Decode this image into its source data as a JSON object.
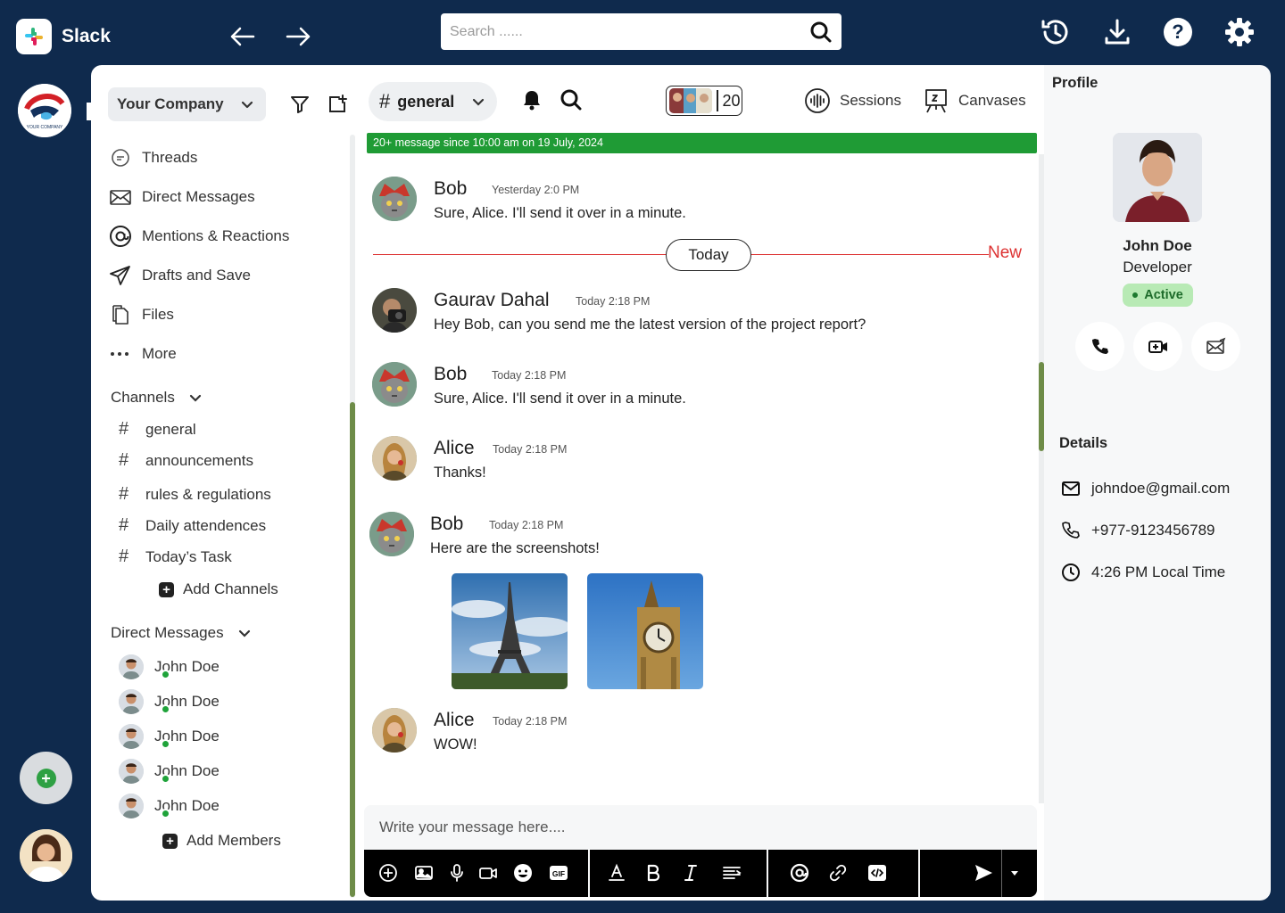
{
  "app": {
    "name": "Slack"
  },
  "search": {
    "placeholder": "Search ......"
  },
  "workspace": {
    "name": "Your Company"
  },
  "company_logo_text": "YOUR COMPANY",
  "nav": [
    {
      "label": "Threads",
      "icon": "threads-icon"
    },
    {
      "label": "Direct Messages",
      "icon": "envelope-icon"
    },
    {
      "label": "Mentions  & Reactions",
      "icon": "at-icon"
    },
    {
      "label": "Drafts and Save",
      "icon": "send-icon"
    },
    {
      "label": "Files",
      "icon": "files-icon"
    },
    {
      "label": "More",
      "icon": "more-icon"
    }
  ],
  "channels": {
    "title": "Channels",
    "items": [
      "general",
      "announcements",
      "rules & regulations",
      "Daily attendences",
      "Today’s Task"
    ],
    "add_label": "Add Channels"
  },
  "direct_messages": {
    "title": "Direct Messages",
    "items": [
      "John Doe",
      "John Doe",
      "John Doe",
      "John Doe",
      "John Doe"
    ],
    "add_label": "Add Members"
  },
  "channel_header": {
    "name": "general",
    "member_count": "20",
    "sessions_label": "Sessions",
    "canvases_label": "Canvases"
  },
  "banner": "20+ message since 10:00 am on 19 July, 2024",
  "divider": {
    "today": "Today",
    "new": "New"
  },
  "messages": [
    {
      "name": "Bob",
      "time": "Yesterday 2:0 PM",
      "text": "Sure, Alice. I'll send it over in a minute."
    },
    {
      "name": "Gaurav Dahal",
      "time": "Today 2:18 PM",
      "text": "Hey Bob, can you send me the latest version of the project report?"
    },
    {
      "name": "Bob",
      "time": "Today 2:18 PM",
      "text": "Sure, Alice. I'll send it over in a minute."
    },
    {
      "name": "Alice",
      "time": "Today 2:18 PM",
      "text": "Thanks!"
    },
    {
      "name": "Bob",
      "time": "Today 2:18 PM",
      "text": "Here are the screenshots!"
    },
    {
      "name": "Alice",
      "time": "Today 2:18 PM",
      "text": "WOW!"
    }
  ],
  "composer": {
    "placeholder": "Write your message here...."
  },
  "profile": {
    "title": "Profile",
    "name": "John Doe",
    "role": "Developer",
    "status": "Active",
    "details_title": "Details",
    "email": "johndoe@gmail.com",
    "phone": "+977-9123456789",
    "local_time": "4:26 PM Local Time"
  },
  "colors": {
    "frame": "#0f2a4d",
    "accent_green": "#1f9b35",
    "new_line": "#dd3333",
    "status_bg": "#b8eab5"
  }
}
